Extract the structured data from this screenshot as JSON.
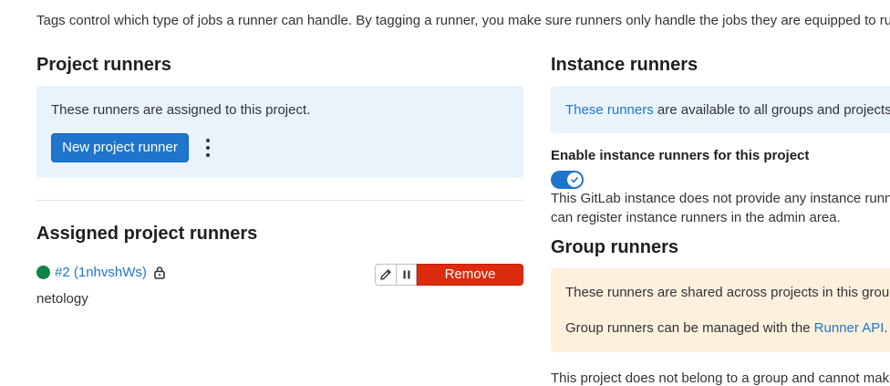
{
  "intro_text": "Tags control which type of jobs a runner can handle. By tagging a runner, you make sure runners only handle the jobs they are equipped to ru",
  "project_runners": {
    "heading": "Project runners",
    "description": "These runners are assigned to this project.",
    "new_button": "New project runner"
  },
  "assigned": {
    "heading": "Assigned project runners",
    "runner": {
      "id_label": "#2 (1nhvshWs)",
      "description": "netology",
      "status": "online",
      "remove_label": "Remove runner"
    }
  },
  "instance_runners": {
    "heading": "Instance runners",
    "link_text": "These runners",
    "desc_rest": " are available to all groups and projects.",
    "toggle_label": "Enable instance runners for this project",
    "toggle_on": true,
    "help_line1": "This GitLab instance does not provide any instance runners",
    "help_line2": "can register instance runners in the admin area."
  },
  "group_runners": {
    "heading": "Group runners",
    "p1": "These runners are shared across projects in this group.",
    "p2_prefix": "Group runners can be managed with the ",
    "p2_link": "Runner API",
    "p2_suffix": ".",
    "bottom_note": "This project does not belong to a group and cannot make"
  },
  "colors": {
    "accent": "#1f75cb",
    "danger": "#dd2b0e",
    "success": "#108548",
    "info_bg": "#e9f3fc",
    "warning_bg": "#fdf1dd"
  }
}
